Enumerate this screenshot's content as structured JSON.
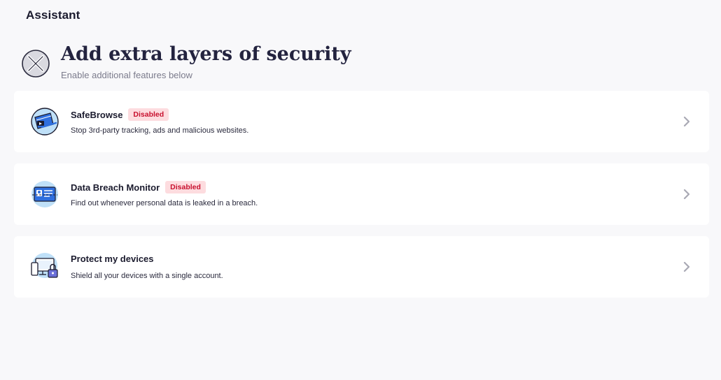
{
  "header": {
    "app_title": "Assistant"
  },
  "hero": {
    "icon": "tools-icon",
    "title": "Add extra layers of security",
    "subtitle": "Enable additional features below"
  },
  "cards": [
    {
      "icon": "safebrowse-icon",
      "title": "SafeBrowse",
      "badge": "Disabled",
      "description": "Stop 3rd-party tracking, ads and malicious websites."
    },
    {
      "icon": "id-card-icon",
      "title": "Data Breach Monitor",
      "badge": "Disabled",
      "description": "Find out whenever personal data is leaked in a breach."
    },
    {
      "icon": "devices-lock-icon",
      "title": "Protect my devices",
      "badge": "",
      "description": "Shield all your devices with a single account."
    }
  ],
  "colors": {
    "background": "#f8f8fa",
    "card": "#ffffff",
    "badge_text": "#c8102e",
    "badge_bg": "#fddcdf",
    "icon_blue": "#2f6fde",
    "icon_light_blue": "#bfe0f8"
  }
}
